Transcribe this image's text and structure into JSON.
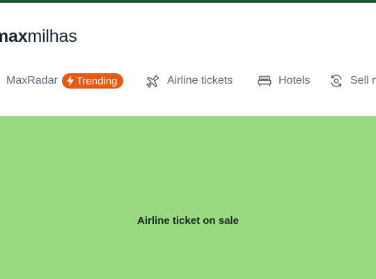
{
  "logo": {
    "bold_part": "ax",
    "rest": "milhas",
    "prefix": "m"
  },
  "nav": {
    "items": [
      {
        "label": "MaxRadar",
        "icon": "none",
        "badge": "Trending",
        "badge_icon": "lightning-bolt-icon"
      },
      {
        "label": "Airline tickets",
        "icon": "airplane-icon"
      },
      {
        "label": "Hotels",
        "icon": "bed-icon"
      },
      {
        "label": "Sell m",
        "icon": "refresh-cycle-icon"
      }
    ]
  },
  "banner": {
    "title": "Airline ticket on sale",
    "background": "#99d982"
  },
  "colors": {
    "accent": "#e35a12",
    "top_strip": "#1f5a2c",
    "text_muted": "#5f6773"
  }
}
